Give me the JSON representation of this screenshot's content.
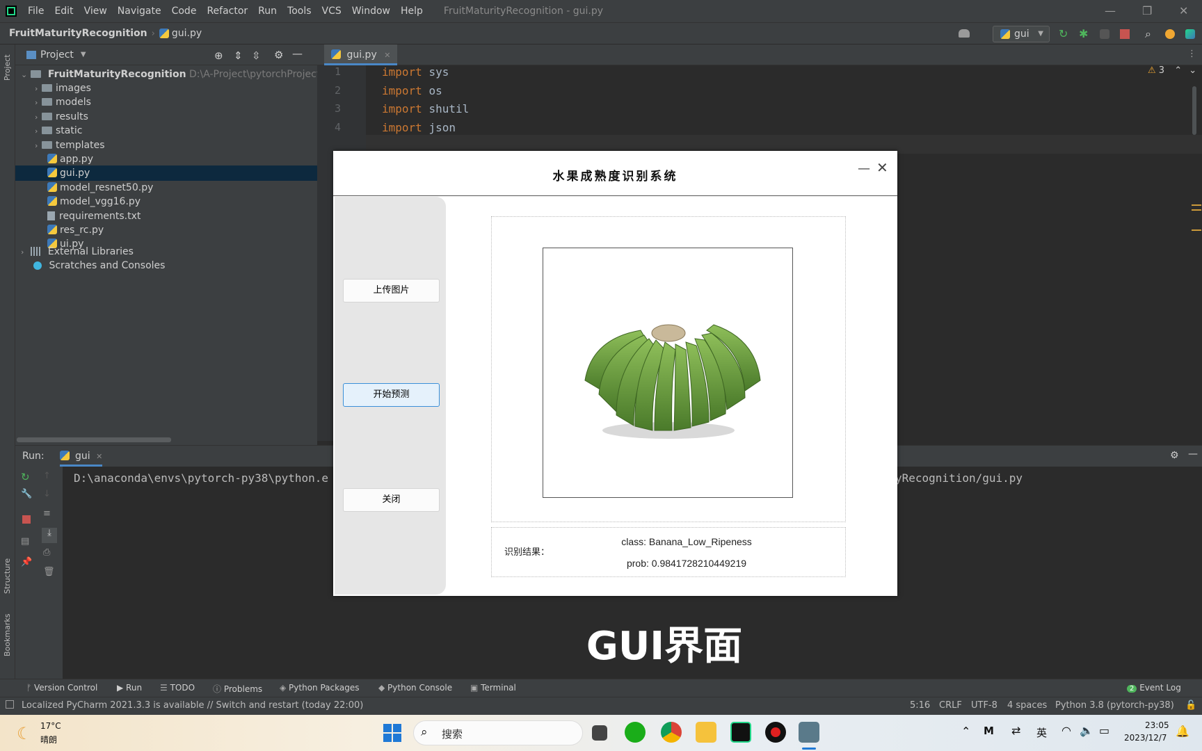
{
  "menubar": {
    "items": [
      "File",
      "Edit",
      "View",
      "Navigate",
      "Code",
      "Refactor",
      "Run",
      "Tools",
      "VCS",
      "Window",
      "Help"
    ],
    "window_title": "FruitMaturityRecognition - gui.py"
  },
  "navbar": {
    "project": "FruitMaturityRecognition",
    "file": "gui.py",
    "run_config": "gui"
  },
  "left_strip": {
    "project": "Project",
    "structure": "Structure",
    "bookmarks": "Bookmarks"
  },
  "project_panel": {
    "title": "Project",
    "root": {
      "name": "FruitMaturityRecognition",
      "path": "D:\\A-Project\\pytorchProject\\cla"
    },
    "items": [
      {
        "label": "images",
        "kind": "folder"
      },
      {
        "label": "models",
        "kind": "folder"
      },
      {
        "label": "results",
        "kind": "folder"
      },
      {
        "label": "static",
        "kind": "folder"
      },
      {
        "label": "templates",
        "kind": "folder"
      },
      {
        "label": "app.py",
        "kind": "py"
      },
      {
        "label": "gui.py",
        "kind": "py"
      },
      {
        "label": "model_resnet50.py",
        "kind": "py"
      },
      {
        "label": "model_vgg16.py",
        "kind": "py"
      },
      {
        "label": "requirements.txt",
        "kind": "txt"
      },
      {
        "label": "res_rc.py",
        "kind": "py"
      },
      {
        "label": "ui.py",
        "kind": "py"
      }
    ],
    "external": "External Libraries",
    "scratches": "Scratches and Consoles"
  },
  "editor": {
    "tab": "gui.py",
    "warnings": "3",
    "lines": [
      {
        "n": "1",
        "kw": "import",
        "mod": "sys"
      },
      {
        "n": "2",
        "kw": "import",
        "mod": "os"
      },
      {
        "n": "3",
        "kw": "import",
        "mod": "shutil"
      },
      {
        "n": "4",
        "kw": "import",
        "mod": "json"
      }
    ]
  },
  "run_panel": {
    "label": "Run:",
    "tab": "gui",
    "output_head": "D:\\anaconda\\envs\\pytorch-py38\\python.e",
    "output_tail": "yRecognition/gui.py"
  },
  "tool_tabs": [
    "Version Control",
    "Run",
    "TODO",
    "Problems",
    "Python Packages",
    "Python Console",
    "Terminal"
  ],
  "event_log": {
    "count": "2",
    "label": "Event Log"
  },
  "status_bar": {
    "message": "Localized PyCharm 2021.3.3 is available // Switch and restart (today 22:00)",
    "position": "5:16",
    "line_sep": "CRLF",
    "encoding": "UTF-8",
    "indent": "4 spaces",
    "interpreter": "Python 3.8 (pytorch-py38)"
  },
  "dialog": {
    "title": "水果成熟度识别系统",
    "buttons": {
      "upload": "上传图片",
      "predict": "开始预测",
      "close": "关闭"
    },
    "result_label": "识别结果：",
    "result_class": "class: Banana_Low_Ripeness",
    "result_prob": "prob: 0.9841728210449219"
  },
  "caption": "GUI界面",
  "taskbar": {
    "weather_temp": "17°C",
    "weather_desc": "晴朗",
    "search_placeholder": "搜索",
    "ime": "英",
    "time": "23:05",
    "date": "2023/12/7"
  },
  "colors": {
    "accent": "#4a88c7",
    "keyword": "#cc7832",
    "selected_row": "#0d293e"
  }
}
